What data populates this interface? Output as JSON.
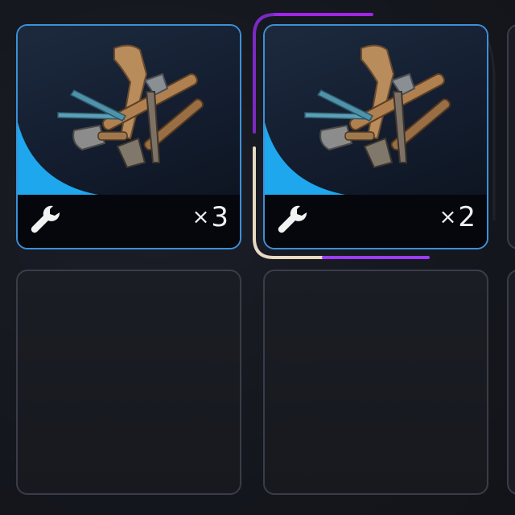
{
  "inventory": {
    "slots": [
      {
        "icon": "wrench-icon",
        "item_icon": "tool-bundle-icon",
        "quantity_prefix": "×",
        "quantity": "3",
        "selected": false
      },
      {
        "icon": "wrench-icon",
        "item_icon": "tool-bundle-icon",
        "quantity_prefix": "×",
        "quantity": "2",
        "selected": true
      },
      {
        "empty": true
      },
      {
        "empty": true
      }
    ],
    "colors": {
      "slot_border": "#3d8fd6",
      "accent": "#1ea7ec",
      "selected_glow_start": "#8a2be2",
      "selected_glow_end": "#e8d9c0"
    }
  }
}
